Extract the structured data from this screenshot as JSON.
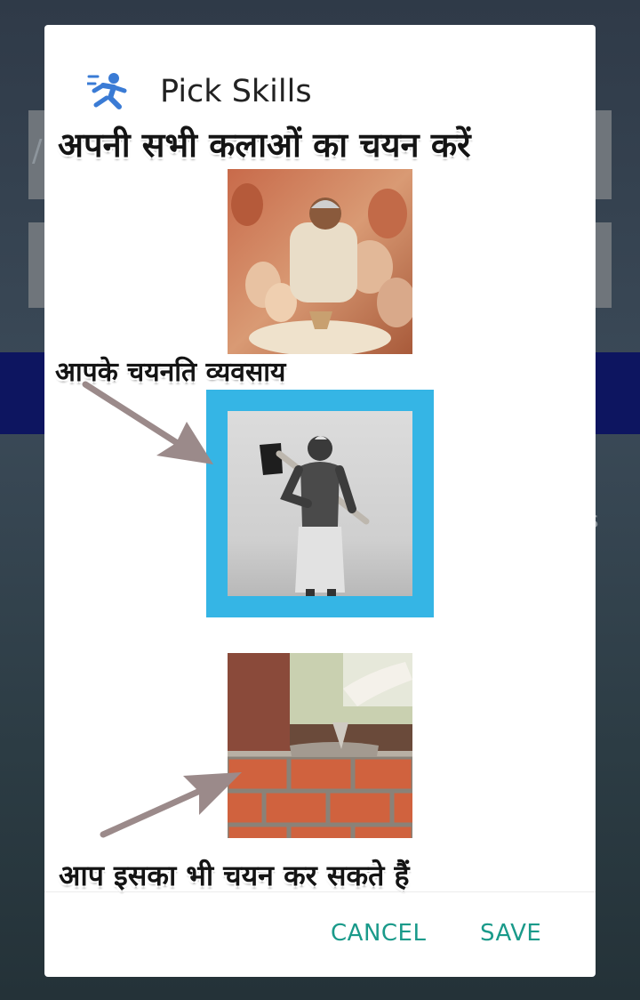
{
  "dialog": {
    "title": "Pick Skills",
    "app_icon": "running-person-icon",
    "caption_top": "अपनी सभी कलाओं का चयन करें",
    "caption_selected": "आपके चयनति व्यवसाय",
    "caption_bottom": "आप इसका भी चयन कर सकते हैं",
    "skills": [
      {
        "name": "potter",
        "selected": false
      },
      {
        "name": "farm-laborer",
        "selected": true
      },
      {
        "name": "bricklayer",
        "selected": false
      }
    ],
    "cancel_label": "CANCEL",
    "save_label": "SAVE"
  },
  "colors": {
    "accent": "#1a9a8a",
    "selection_frame": "#35b5e5",
    "arrow": "#9b8a8a",
    "scrim_band": "#0d1560"
  }
}
